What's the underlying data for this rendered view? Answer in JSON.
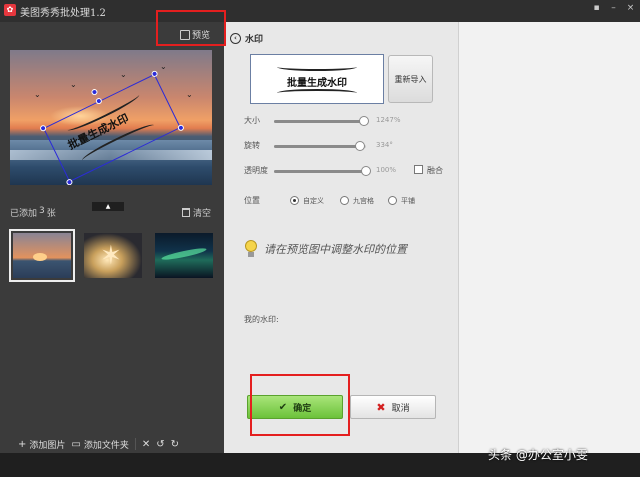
{
  "window": {
    "title": "美图秀秀批处理1.2",
    "logo_glyph": "✿",
    "controls": [
      "▪",
      "–",
      "×"
    ]
  },
  "left": {
    "preview_label": "预览",
    "watermark_text": "批量生成水印",
    "added_prefix": "已添加",
    "added_count": "3",
    "added_suffix": "张",
    "clear_label": "清空",
    "collapse_glyph": "▲",
    "bottom": {
      "add_image_icon": "+",
      "add_image": "添加图片",
      "add_folder_icon": "▭",
      "add_folder": "添加文件夹",
      "delete_glyph": "✕",
      "rotate_left_glyph": "↺",
      "rotate_right_glyph": "↻"
    }
  },
  "right": {
    "back_glyph": "‹",
    "section_title": "水印",
    "watermark_preview_text": "批量生成水印",
    "reimport_label": "重新导入",
    "sliders": [
      {
        "label": "大小",
        "value_text": "1247%",
        "fraction": 0.98
      },
      {
        "label": "旋转",
        "value_text": "334°",
        "fraction": 0.93
      },
      {
        "label": "透明度",
        "value_text": "100%",
        "fraction": 1.0
      }
    ],
    "blend_label": "融合",
    "position_label": "位置",
    "position_options": [
      "自定义",
      "九宫格",
      "平铺"
    ],
    "position_selected": "自定义",
    "hint": "请在预览图中调整水印的位置",
    "my_watermark_label": "我的水印:",
    "ok_icon": "✔",
    "ok_label": "确定",
    "cancel_icon": "✖",
    "cancel_label": "取消"
  },
  "credit": "头条 @办公室小雯",
  "colors": {
    "highlight": "#e41f1f",
    "ok_green": "#6cc23a",
    "selection_blue": "#2b2bd8"
  }
}
